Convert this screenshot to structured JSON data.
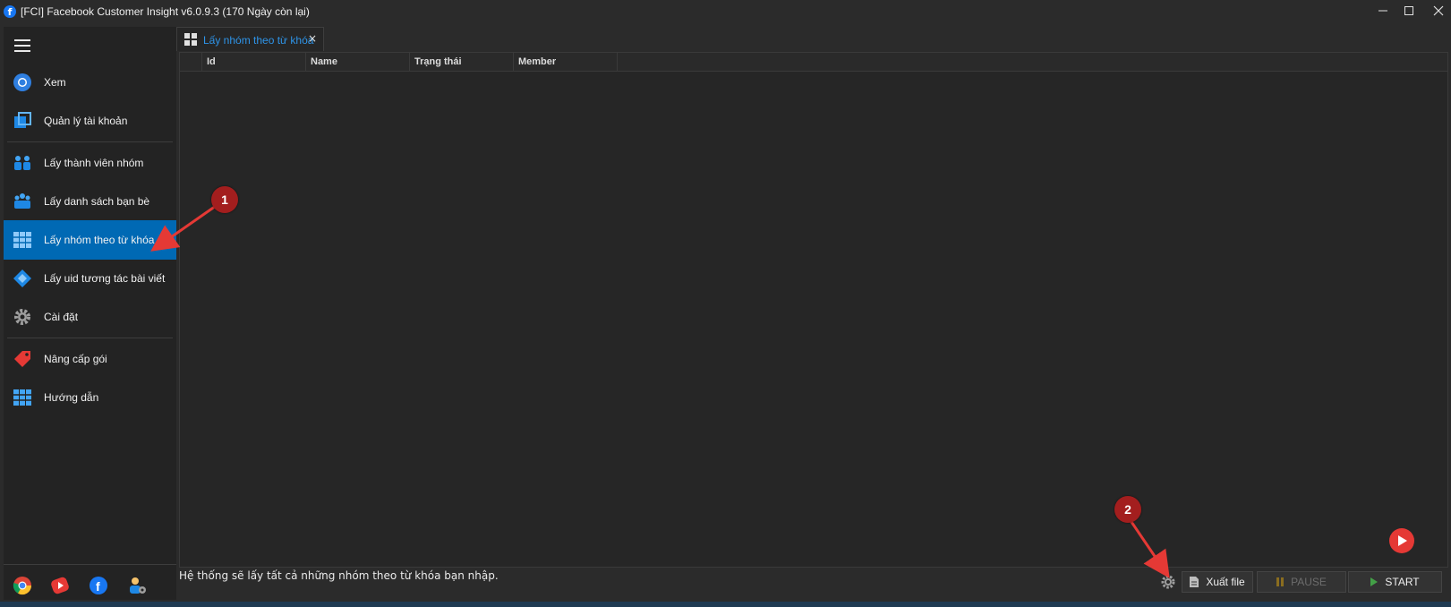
{
  "window": {
    "title": "[FCI] Facebook Customer Insight v6.0.9.3 (170 Ngày còn lại)",
    "controls": [
      "minimize",
      "maximize",
      "close"
    ]
  },
  "sidebar": {
    "items": [
      {
        "label": "Xem",
        "icon": "chrome-circle-icon"
      },
      {
        "label": "Quản lý tài khoản",
        "icon": "account-stack-icon"
      },
      {
        "label": "Lấy thành viên nhóm",
        "icon": "group-members-icon"
      },
      {
        "label": "Lấy danh sách bạn bè",
        "icon": "friends-list-icon"
      },
      {
        "label": "Lấy nhóm theo từ khóa",
        "icon": "keyword-groups-icon",
        "active": true
      },
      {
        "label": "Lấy uid tương tác bài viết",
        "icon": "post-interaction-icon"
      },
      {
        "label": "Cài đặt",
        "icon": "gear-icon"
      },
      {
        "label": "Nâng cấp gói",
        "icon": "price-tag-icon"
      },
      {
        "label": "Hướng dẫn",
        "icon": "guide-grid-icon"
      }
    ],
    "bottom_icons": [
      "chrome-icon",
      "youtube-icon",
      "facebook-icon",
      "admin-user-icon"
    ]
  },
  "tab": {
    "label": "Lấy nhóm theo từ khóa",
    "close": "×"
  },
  "table": {
    "columns": [
      "Id",
      "Name",
      "Trạng thái",
      "Member"
    ],
    "rows": []
  },
  "status": {
    "message": "Hệ thống sẽ lấy tất cả những nhóm theo từ khóa bạn nhập."
  },
  "buttons": {
    "export": "Xuất file",
    "pause": "PAUSE",
    "start": "START"
  },
  "annotations": [
    "1",
    "2"
  ],
  "colors": {
    "accent": "#0069b4",
    "tab_text": "#2e94e8",
    "annotation": "#a31e1e",
    "arrow": "#e53935"
  }
}
